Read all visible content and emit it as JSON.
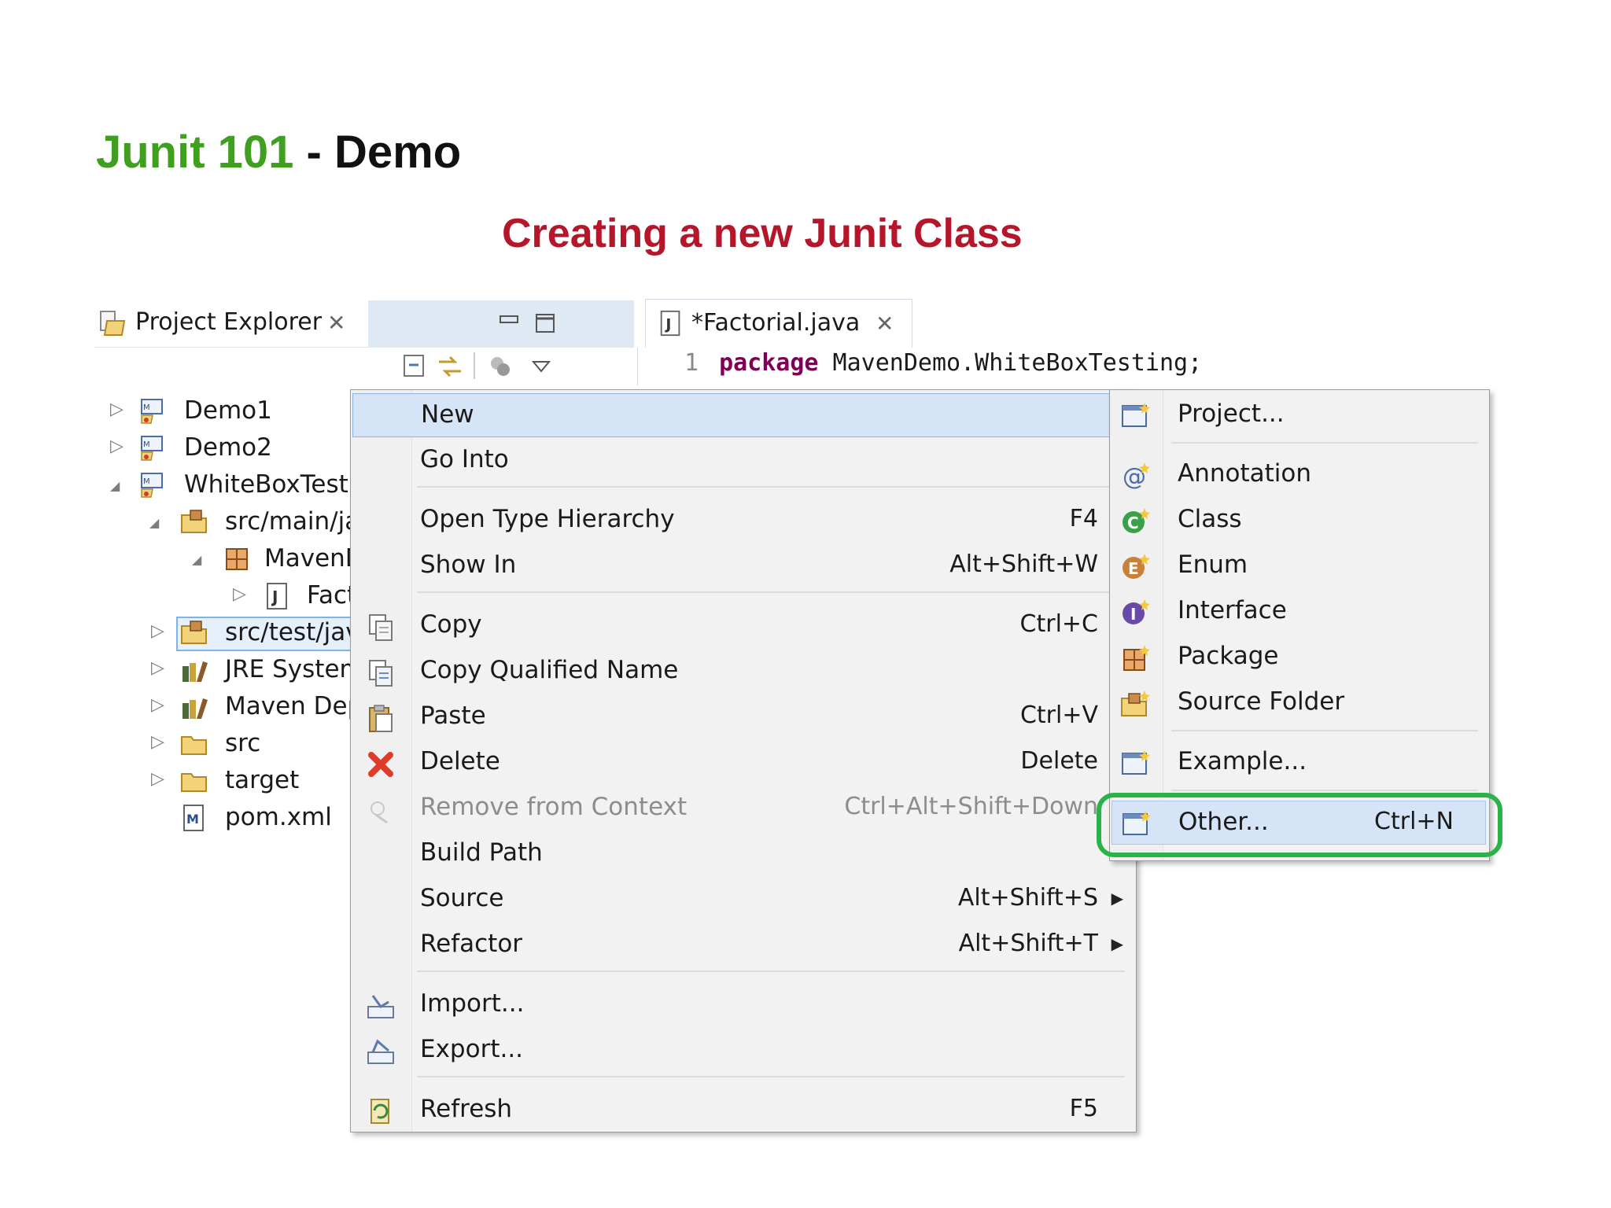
{
  "slide": {
    "title_part1": "Junit 101",
    "title_part2": " - Demo",
    "subtitle": "Creating a new Junit Class"
  },
  "colors": {
    "title_green": "#3f9f1f",
    "subtitle_red": "#b5162a",
    "highlight_green": "#2bb34a",
    "menu_hover": "#d5e5f7",
    "keyword": "#7f0055"
  },
  "project_explorer": {
    "tab_label": "Project Explorer",
    "tree": [
      {
        "label": "Demo1",
        "twisty": "▷",
        "icon": "maven-project-icon"
      },
      {
        "label": "Demo2",
        "twisty": "▷",
        "icon": "maven-project-icon"
      },
      {
        "label": "WhiteBoxTesti",
        "twisty": "◢",
        "icon": "maven-project-icon"
      },
      {
        "label": "src/main/ja",
        "twisty": "◢",
        "icon": "source-folder-icon"
      },
      {
        "label": "MavenD",
        "twisty": "◢",
        "icon": "package-icon"
      },
      {
        "label": "Fact",
        "twisty": "▷",
        "icon": "java-file-icon"
      },
      {
        "label": "src/test/jav",
        "twisty": "▷",
        "icon": "source-folder-icon"
      },
      {
        "label": "JRE System",
        "twisty": "▷",
        "icon": "library-icon"
      },
      {
        "label": "Maven Dep",
        "twisty": "▷",
        "icon": "library-icon"
      },
      {
        "label": "src",
        "twisty": "▷",
        "icon": "folder-icon"
      },
      {
        "label": "target",
        "twisty": "▷",
        "icon": "folder-icon"
      },
      {
        "label": "pom.xml",
        "twisty": "",
        "icon": "pom-file-icon"
      }
    ]
  },
  "editor": {
    "tab_label": "*Factorial.java",
    "line_number": "1",
    "keyword": "package",
    "code": " MavenDemo.WhiteBoxTesting;"
  },
  "context_menu": {
    "items": [
      {
        "label": "New",
        "accel": "",
        "submenu": true
      },
      {
        "label": "Go Into",
        "accel": ""
      },
      {
        "label": "Open Type Hierarchy",
        "accel": "F4"
      },
      {
        "label": "Show In",
        "accel": "Alt+Shift+W",
        "submenu": true
      },
      {
        "label": "Copy",
        "accel": "Ctrl+C",
        "icon": "copy-icon"
      },
      {
        "label": "Copy Qualified Name",
        "accel": "",
        "icon": "copy-qualified-icon"
      },
      {
        "label": "Paste",
        "accel": "Ctrl+V",
        "icon": "paste-icon"
      },
      {
        "label": "Delete",
        "accel": "Delete",
        "icon": "delete-icon"
      },
      {
        "label": "Remove from Context",
        "accel": "Ctrl+Alt+Shift+Down",
        "disabled": true,
        "icon": "remove-context-icon"
      },
      {
        "label": "Build Path",
        "accel": "",
        "submenu": true
      },
      {
        "label": "Source",
        "accel": "Alt+Shift+S",
        "submenu": true
      },
      {
        "label": "Refactor",
        "accel": "Alt+Shift+T",
        "submenu": true
      },
      {
        "label": "Import...",
        "accel": "",
        "icon": "import-icon"
      },
      {
        "label": "Export...",
        "accel": "",
        "icon": "export-icon"
      },
      {
        "label": "Refresh",
        "accel": "F5",
        "icon": "refresh-icon"
      }
    ]
  },
  "submenu": {
    "items": [
      {
        "label": "Project...",
        "icon": "new-project-icon"
      },
      {
        "label": "Annotation",
        "icon": "annotation-icon"
      },
      {
        "label": "Class",
        "icon": "class-icon"
      },
      {
        "label": "Enum",
        "icon": "enum-icon"
      },
      {
        "label": "Interface",
        "icon": "interface-icon"
      },
      {
        "label": "Package",
        "icon": "package-icon"
      },
      {
        "label": "Source Folder",
        "icon": "source-folder-icon"
      },
      {
        "label": "Example...",
        "icon": "example-icon"
      },
      {
        "label": "Other...",
        "accel": "Ctrl+N",
        "icon": "other-wizard-icon"
      }
    ]
  }
}
